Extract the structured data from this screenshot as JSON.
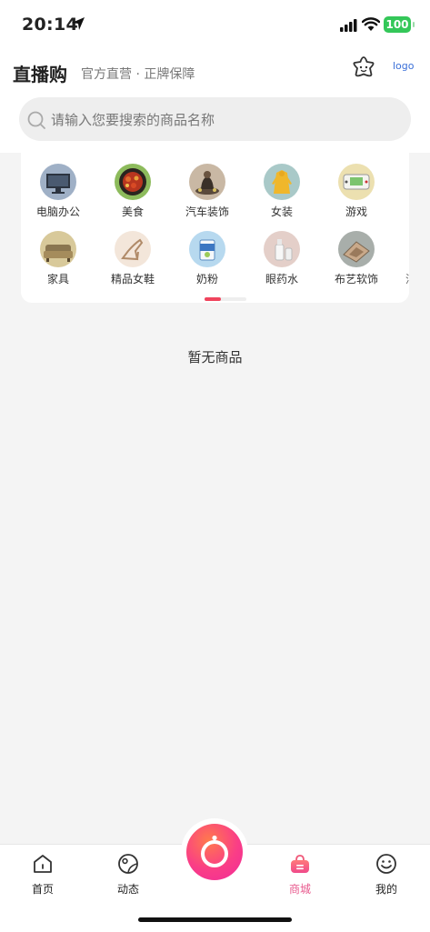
{
  "status_bar": {
    "time": "20:14",
    "battery": "100"
  },
  "header": {
    "title": "直播购",
    "subtitle": "官方直营 · 正牌保障",
    "logo_text": "logo"
  },
  "search": {
    "placeholder": "请输入您要搜索的商品名称"
  },
  "categories": [
    {
      "label": "电脑办公",
      "icon": "computer-icon"
    },
    {
      "label": "美食",
      "icon": "food-icon"
    },
    {
      "label": "汽车装饰",
      "icon": "car-decor-icon"
    },
    {
      "label": "女装",
      "icon": "womens-clothing-icon"
    },
    {
      "label": "游戏",
      "icon": "game-console-icon"
    },
    {
      "label": "家具",
      "icon": "furniture-icon"
    },
    {
      "label": "精品女鞋",
      "icon": "womens-shoes-icon"
    },
    {
      "label": "奶粉",
      "icon": "milk-powder-icon"
    },
    {
      "label": "眼药水",
      "icon": "eye-drops-icon"
    },
    {
      "label": "布艺软饰",
      "icon": "fabric-decor-icon"
    }
  ],
  "categories_overflow": "洁",
  "empty_state": "暂无商品",
  "tabbar": {
    "items": [
      {
        "label": "首页",
        "icon": "home-icon"
      },
      {
        "label": "动态",
        "icon": "moments-icon"
      },
      {
        "label": "商城",
        "icon": "shop-bag-icon"
      },
      {
        "label": "我的",
        "icon": "profile-icon"
      }
    ],
    "active": "商城",
    "center_icon": "camera-icon"
  },
  "colors": {
    "accent": "#f0445d",
    "tab_active": "#e85a8e",
    "battery": "#34c759"
  }
}
